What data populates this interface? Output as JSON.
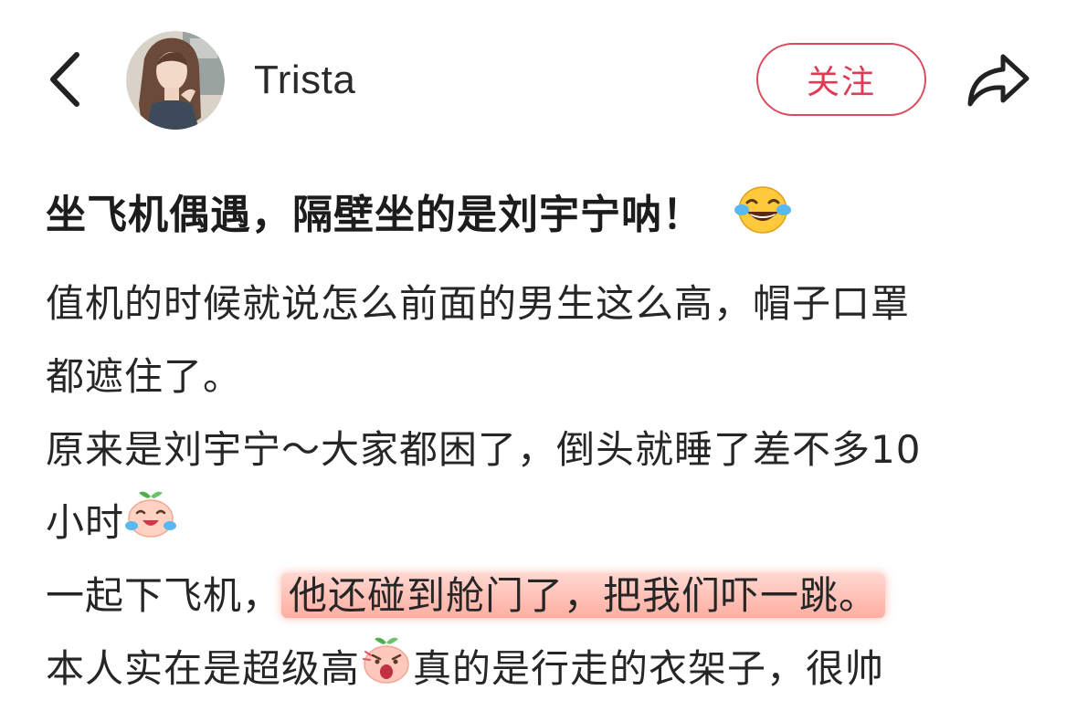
{
  "header": {
    "username": "Trista",
    "follow_label": "关注",
    "back_icon": "chevron-left-icon",
    "share_icon": "share-arrow-icon",
    "accent_color": "#e03a55"
  },
  "post": {
    "title": "坐飞机偶遇，隔壁坐的是刘宇宁呐！",
    "title_emoji": "tears-of-joy-emoji",
    "lines": {
      "l1": "值机的时候就说怎么前面的男生这么高，帽子口罩",
      "l2": "都遮住了。",
      "l3": "原来是刘宇宁～大家都困了，倒头就睡了差不多10",
      "l4": "小时",
      "l5_pre": "一起下飞机，",
      "l5_highlight": "他还碰到舱门了，把我们吓一跳。",
      "l6_pre": "本人实在是超级高",
      "l6_post": "真的是行走的衣架子，很帅"
    },
    "highlight_color": "#ff8a78"
  }
}
